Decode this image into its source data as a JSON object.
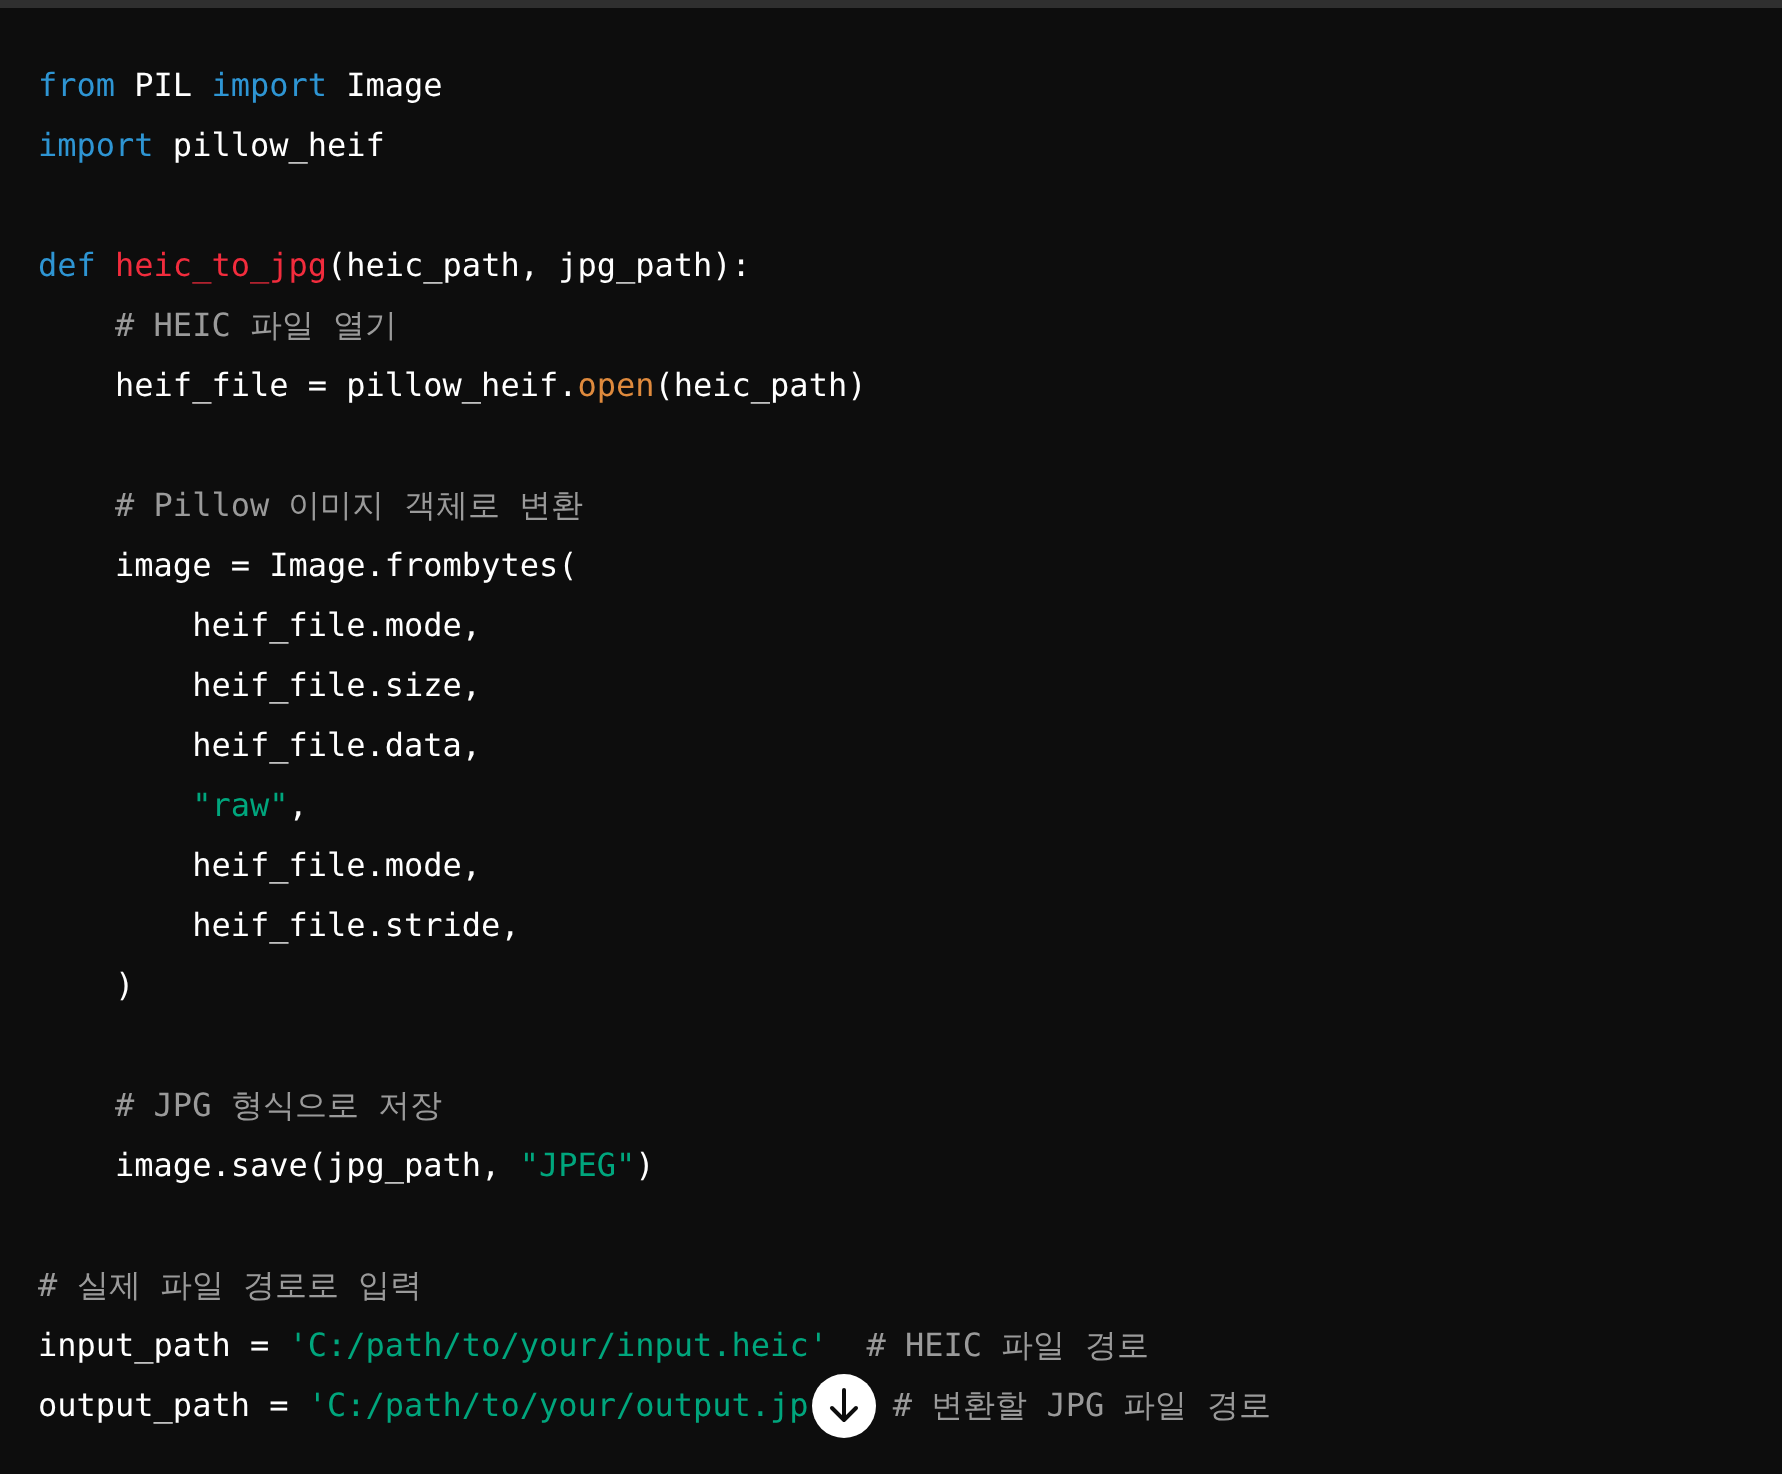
{
  "code_blocks": [
    [
      {
        "tokens": [
          {
            "kind": "keyword",
            "text": "from"
          },
          {
            "kind": "plain",
            "text": " PIL "
          },
          {
            "kind": "keyword",
            "text": "import"
          },
          {
            "kind": "plain",
            "text": " Image"
          }
        ]
      },
      {
        "tokens": [
          {
            "kind": "keyword",
            "text": "import"
          },
          {
            "kind": "plain",
            "text": " pillow_heif"
          }
        ]
      }
    ],
    [
      {
        "tokens": [
          {
            "kind": "keyword",
            "text": "def "
          },
          {
            "kind": "function",
            "text": "heic_to_jpg"
          },
          {
            "kind": "plain",
            "text": "(heic_path, jpg_path):"
          }
        ]
      },
      {
        "tokens": [
          {
            "kind": "comment",
            "text": "    # HEIC 파일 열기"
          }
        ]
      },
      {
        "tokens": [
          {
            "kind": "plain",
            "text": "    heif_file = pillow_heif."
          },
          {
            "kind": "method",
            "text": "open"
          },
          {
            "kind": "plain",
            "text": "(heic_path)"
          }
        ]
      }
    ],
    [
      {
        "tokens": [
          {
            "kind": "comment",
            "text": "    # Pillow 이미지 객체로 변환"
          }
        ]
      },
      {
        "tokens": [
          {
            "kind": "plain",
            "text": "    image = Image.frombytes("
          }
        ]
      },
      {
        "tokens": [
          {
            "kind": "plain",
            "text": "        heif_file.mode,"
          }
        ]
      },
      {
        "tokens": [
          {
            "kind": "plain",
            "text": "        heif_file.size,"
          }
        ]
      },
      {
        "tokens": [
          {
            "kind": "plain",
            "text": "        heif_file.data,"
          }
        ]
      },
      {
        "tokens": [
          {
            "kind": "string",
            "text": "        \"raw\""
          },
          {
            "kind": "plain",
            "text": ","
          }
        ]
      },
      {
        "tokens": [
          {
            "kind": "plain",
            "text": "        heif_file.mode,"
          }
        ]
      },
      {
        "tokens": [
          {
            "kind": "plain",
            "text": "        heif_file.stride,"
          }
        ]
      },
      {
        "tokens": [
          {
            "kind": "plain",
            "text": "    )"
          }
        ]
      }
    ],
    [
      {
        "tokens": [
          {
            "kind": "comment",
            "text": "    # JPG 형식으로 저장"
          }
        ]
      },
      {
        "tokens": [
          {
            "kind": "plain",
            "text": "    image.save(jpg_path, "
          },
          {
            "kind": "string",
            "text": "\"JPEG\""
          },
          {
            "kind": "plain",
            "text": ")"
          }
        ]
      }
    ],
    [
      {
        "tokens": [
          {
            "kind": "comment",
            "text": "# 실제 파일 경로로 입력"
          }
        ]
      },
      {
        "tokens": [
          {
            "kind": "plain",
            "text": "input_path = "
          },
          {
            "kind": "string",
            "text": "'C:/path/to/your/input.heic'"
          },
          {
            "kind": "comment",
            "text": "  # HEIC 파일 경로"
          }
        ]
      },
      {
        "parts": [
          [
            {
              "kind": "plain",
              "text": "output_path = "
            },
            {
              "kind": "string",
              "text": "'C:/path/to/your/output.jp"
            }
          ],
          [
            {
              "kind": "comment",
              "text": "# 변환할 JPG 파일 경로"
            }
          ]
        ]
      }
    ]
  ]
}
